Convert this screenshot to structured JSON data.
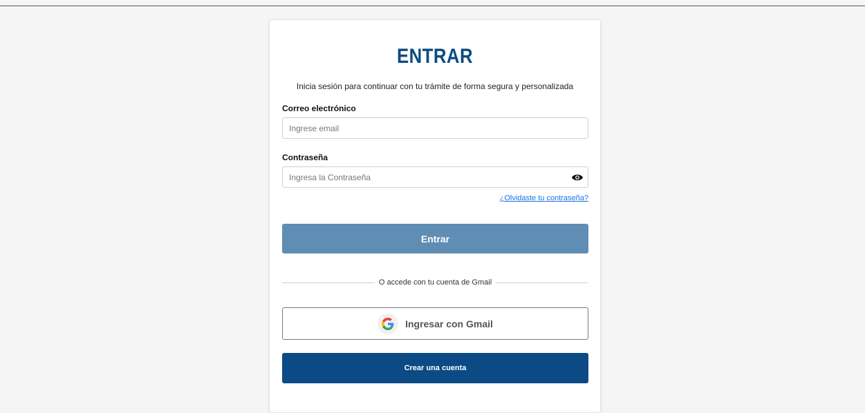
{
  "login": {
    "title": "ENTRAR",
    "subtitle": "Inicia sesión para continuar con tu trámite de forma segura y personalizada",
    "email_label": "Correo electrónico",
    "email_placeholder": "Ingrese email",
    "password_label": "Contraseña",
    "password_placeholder": "Ingresa la Contraseña",
    "forgot_link": "¿Olvidaste tu contraseña?",
    "submit_label": "Entrar",
    "divider_text": "O accede con tu cuenta de Gmail",
    "google_label": "Ingresar con Gmail",
    "create_label": "Crear una cuenta"
  },
  "icons": {
    "eye": "eye-icon",
    "google": "google-icon"
  },
  "colors": {
    "brand": "#0b4a84",
    "submit": "#5f8db4",
    "link": "#1a73e8",
    "background": "#f5f5f5"
  }
}
